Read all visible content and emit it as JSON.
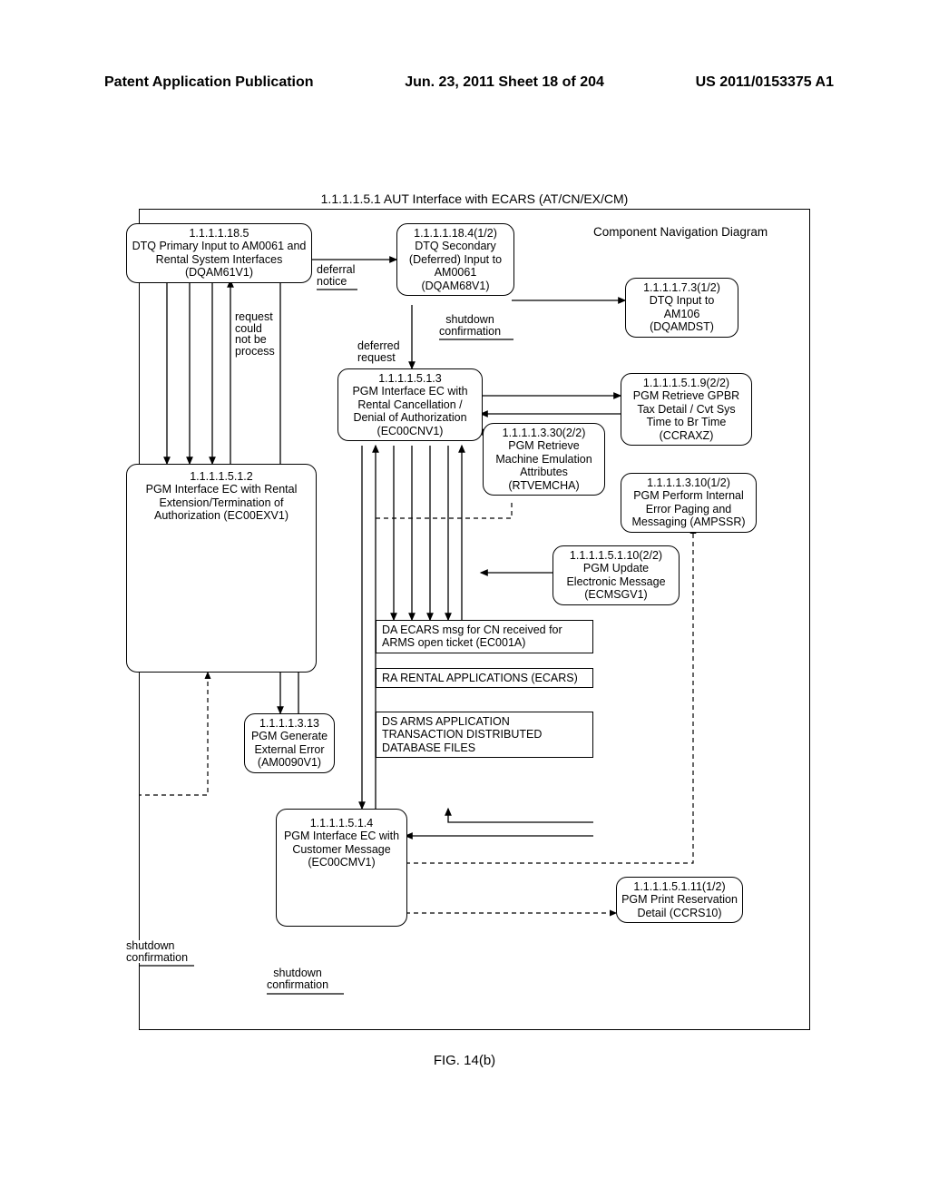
{
  "header": {
    "left": "Patent Application Publication",
    "middle": "Jun. 23, 2011  Sheet 18 of 204",
    "right": "US 2011/0153375 A1"
  },
  "figure_caption": "FIG. 14(b)",
  "frame_title": "1.1.1.1.5.1 AUT Interface with ECARS (AT/CN/EX/CM)",
  "nodes": {
    "n1": {
      "id": "1.1.1.1.18.5",
      "text": "DTQ Primary Input to AM0061 and Rental System Interfaces (DQAM61V1)"
    },
    "n2": {
      "id": "1.1.1.1.18.4(1/2)",
      "text": "DTQ Secondary (Deferred) Input to AM0061 (DQAM68V1)"
    },
    "n3": {
      "id": "1.1.1.1.7.3(1/2)",
      "text": "DTQ Input to AM106 (DQAMDST)"
    },
    "n4": {
      "id": "1.1.1.1.5.1.3",
      "text": "PGM Interface EC with Rental Cancellation / Denial of Authorization (EC00CNV1)"
    },
    "n5": {
      "id": "1.1.1.1.5.1.9(2/2)",
      "text": "PGM Retrieve GPBR Tax Detail / Cvt Sys Time to Br Time (CCRAXZ)"
    },
    "n6": {
      "id": "1.1.1.1.3.30(2/2)",
      "text": "PGM Retrieve Machine Emulation Attributes (RTVEMCHA)"
    },
    "n7": {
      "id": "1.1.1.1.5.1.2",
      "text": "PGM Interface EC with Rental Extension/Termination of Authorization (EC00EXV1)"
    },
    "n8": {
      "id": "1.1.1.1.3.10(1/2)",
      "text": "PGM Perform Internal Error Paging and Messaging (AMPSSR)"
    },
    "n9": {
      "id": "1.1.1.1.5.1.10(2/2)",
      "text": "PGM Update Electronic Message (ECMSGV1)"
    },
    "n10": {
      "id": "1.1.1.1.3.13",
      "text": "PGM Generate External Error (AM0090V1)"
    },
    "n11": {
      "id": "1.1.1.1.5.1.4",
      "text": "PGM Interface EC with Customer Message (EC00CMV1)"
    },
    "n12": {
      "id": "1.1.1.1.5.1.11(1/2)",
      "text": "PGM Print Reservation Detail (CCRS10)"
    }
  },
  "rects": {
    "r1": "DA ECARS msg for CN received for ARMS open ticket (EC001A)",
    "r2": "RA RENTAL APPLICATIONS (ECARS)",
    "r3": "DS ARMS APPLICATION TRANSACTION DISTRIBUTED DATABASE FILES"
  },
  "labels": {
    "cnd": "Component Navigation Diagram",
    "deferral_notice": "deferral\nnotice",
    "deferred_request": "deferred\nrequest",
    "shutdown_confirmation": "shutdown\nconfirmation",
    "request_could_not_be_process": "request\ncould\nnot be\nprocess",
    "shutdown_confirmation_2": "shutdown\nconfirmation",
    "shutdown_confirmation_3": "shutdown\nconfirmation"
  }
}
